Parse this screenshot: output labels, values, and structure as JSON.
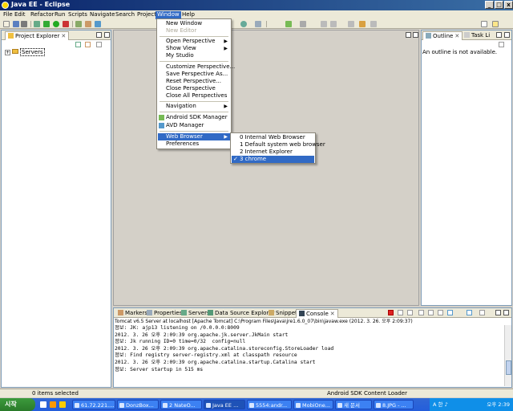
{
  "window": {
    "title": "Java EE - Eclipse"
  },
  "menubar": [
    "File",
    "Edit",
    "Refactor",
    "Run",
    "Scripts",
    "Navigate",
    "Search",
    "Project",
    "Window",
    "Help"
  ],
  "window_menu": {
    "items": [
      {
        "label": "New Window",
        "enabled": true
      },
      {
        "label": "New Editor",
        "enabled": false
      },
      {
        "label": "Open Perspective",
        "submenu": true
      },
      {
        "label": "Show View",
        "submenu": true
      },
      {
        "label": "My Studio"
      },
      {
        "label": "Customize Perspective..."
      },
      {
        "label": "Save Perspective As..."
      },
      {
        "label": "Reset Perspective..."
      },
      {
        "label": "Close Perspective"
      },
      {
        "label": "Close All Perspectives"
      },
      {
        "label": "Navigation",
        "submenu": true
      },
      {
        "label": "Android SDK Manager"
      },
      {
        "label": "AVD Manager"
      },
      {
        "label": "Web Browser",
        "submenu": true,
        "highlighted": true
      },
      {
        "label": "Preferences"
      }
    ]
  },
  "web_browser_menu": {
    "items": [
      {
        "label": "0 Internal Web Browser"
      },
      {
        "label": "1 Default system web browser"
      },
      {
        "label": "2 Internet Explorer"
      },
      {
        "label": "3 chrome",
        "checked": true,
        "highlighted": true
      }
    ]
  },
  "project_explorer": {
    "tab_label": "Project Explorer",
    "tree": [
      {
        "label": "Servers",
        "expanded": false
      }
    ]
  },
  "outline": {
    "tabs": [
      "Outline",
      "Task Li"
    ],
    "message": "An outline is not available."
  },
  "console": {
    "tabs": [
      "Markers",
      "Properties",
      "Servers",
      "Data Source Explorer",
      "Snippets",
      "Console"
    ],
    "info": "Tomcat v6.5 Server at localhost [Apache Tomcat] C:\\Program Files\\Java\\jre1.6.0_07\\bin\\javaw.exe (2012. 3. 26. 오후 2:09:37)",
    "lines": [
      "정보: JK: ajp13 listening on /0.0.0.0:8009",
      "2012. 3. 26 오후 2:09:39 org.apache.jk.server.JkMain start",
      "정보: Jk running ID=0 time=0/32  config=null",
      "2012. 3. 26 오후 2:09:39 org.apache.catalina.storeconfig.StoreLoader load",
      "정보: Find registry server-registry.xml at classpath resource",
      "2012. 3. 26 오후 2:09:39 org.apache.catalina.startup.Catalina start",
      "정보: Server startup in 515 ms"
    ]
  },
  "statusbar": {
    "left": "0 items selected",
    "right": "Android SDK Content Loader"
  },
  "taskbar": {
    "start": "시작",
    "tasks": [
      "61.72.221....",
      "DonzBox...",
      "2 NateO...",
      "Java EE ...",
      "5554:andr...",
      "MobiOne...",
      "새 문서",
      "8.JPG - ..."
    ],
    "tray_ime": "A 한 ♪",
    "clock": "오후 2:39"
  },
  "colors": {
    "title_gradient_start": "#0a246a",
    "menu_highlight": "#316ac5",
    "taskbar": "#245edb"
  }
}
